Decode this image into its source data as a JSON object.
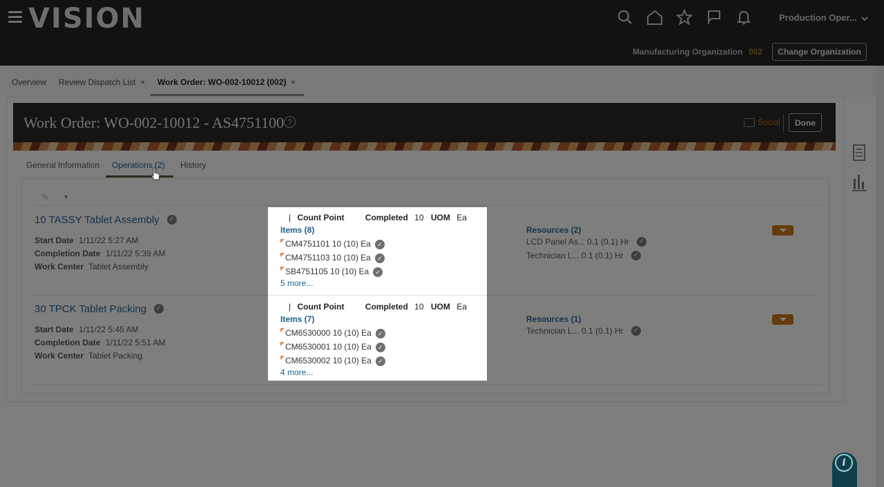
{
  "header": {
    "logo": "VISION",
    "user_menu": "Production Oper...",
    "org_label": "Manufacturing Organization",
    "org_code": "002",
    "change_org": "Change Organization"
  },
  "top_tabs": [
    {
      "label": "Overview",
      "closable": false,
      "active": false
    },
    {
      "label": "Review Dispatch List",
      "closable": true,
      "active": false
    },
    {
      "label": "Work Order: WO-002-10012 (002)",
      "closable": true,
      "active": true
    }
  ],
  "tab_close_glyph": "×",
  "work_order": {
    "title": "Work Order: WO-002-10012 - AS4751100",
    "help_glyph": "?",
    "social": "Social",
    "done": "Done"
  },
  "sub_tabs": [
    {
      "label": "General Information",
      "active": false
    },
    {
      "label": "Operations (2)",
      "active": true
    },
    {
      "label": "History",
      "active": false
    }
  ],
  "operations": [
    {
      "title": "10 TASSY Tablet Assembly",
      "start_label": "Start Date",
      "start_value": "1/11/22 5:27 AM",
      "completion_label": "Completion Date",
      "completion_value": "1/11/22 5:39 AM",
      "wc_label": "Work Center",
      "wc_value": "Tablet Assembly",
      "resources_title": "Resources (2)",
      "resources": [
        "LCD Panel As... 0.1 (0.1) Hr",
        "Technician L... 0.1 (0.1) Hr"
      ]
    },
    {
      "title": "30 TPCK Tablet Packing",
      "start_label": "Start Date",
      "start_value": "1/11/22 5:45 AM",
      "completion_label": "Completion Date",
      "completion_value": "1/11/22 5:51 AM",
      "wc_label": "Work Center",
      "wc_value": "Tablet Packing",
      "resources_title": "Resources (1)",
      "resources": [
        "Technician L... 0.1 (0.1) Hr"
      ]
    }
  ],
  "popup": {
    "sections": [
      {
        "pipe": "|",
        "count_point": "Count Point",
        "completed_label": "Completed",
        "completed_value": "10",
        "uom_label": "UOM",
        "uom_value": "Ea",
        "items_title": "Items (8)",
        "items": [
          "CM4751101 10 (10) Ea",
          "CM4751103 10 (10) Ea",
          "SB4751105 10 (10) Ea"
        ],
        "more": "5 more..."
      },
      {
        "pipe": "|",
        "count_point": "Count Point",
        "completed_label": "Completed",
        "completed_value": "10",
        "uom_label": "UOM",
        "uom_value": "Ea",
        "items_title": "Items (7)",
        "items": [
          "CM6530000 10 (10) Ea",
          "CM6530001 10 (10) Ea",
          "CM6530002 10 (10) Ea"
        ],
        "more": "4 more..."
      }
    ]
  },
  "check_glyph": "✓",
  "info_glyph": "i",
  "edit_glyph": "✎",
  "dropdown_glyph": "▼",
  "icons": [
    "hamburger-icon",
    "search-icon",
    "home-icon",
    "star-icon",
    "flag-icon",
    "bell-icon",
    "chevron-down-icon",
    "social-icon",
    "help-icon",
    "document-icon",
    "bar-chart-icon",
    "info-icon",
    "edit-icon"
  ]
}
